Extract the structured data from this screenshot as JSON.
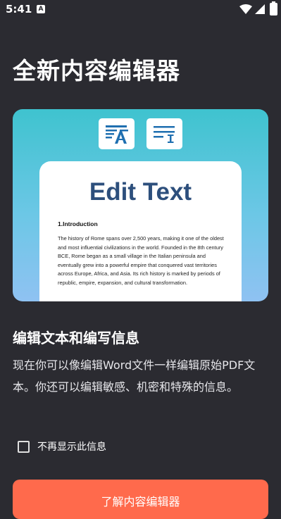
{
  "status_bar": {
    "time": "5:41",
    "notification_letter": "A"
  },
  "title": "全新内容编辑器",
  "hero": {
    "doc_title": "Edit Text",
    "doc_heading": "1.Introduction",
    "doc_body": "The history of Rome spans over 2,500 years, making it one of the oldest and most influential civilizations in the world. Founded in the 8th century BCE, Rome began as a small village in the Italian peninsula and eventually grew into a powerful empire that conquered vast territories across Europe, Africa, and Asia. Its rich history is marked by periods of republic, empire, expansion, and cultural transformation."
  },
  "section": {
    "heading": "编辑文本和编写信息",
    "description": "现在你可以像编辑Word文件一样编辑原始PDF文本。你还可以编辑敏感、机密和特殊的信息。"
  },
  "checkbox": {
    "label": "不再显示此信息",
    "checked": false
  },
  "cta": {
    "label": "了解内容编辑器"
  },
  "colors": {
    "background": "#2b2b31",
    "accent": "#ff6a4c",
    "doc_title": "#2d4f7c"
  }
}
